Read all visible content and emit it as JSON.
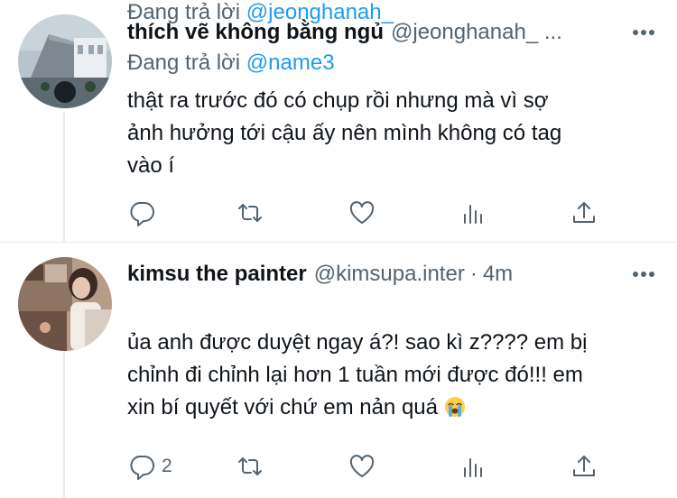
{
  "replies": [
    {
      "display_name": "thích vẽ không bằng ngủ",
      "handle": "@jeonghanah_ ...",
      "timestamp": "",
      "replying_prefix": "Đang trả lời",
      "replying_to": "@name3",
      "lines": [
        "thật ra trước đó có chụp rồi nhưng mà vì sợ",
        "ảnh hưởng tới cậu ấy nên mình không có tag",
        "vào í"
      ],
      "counts": {
        "reply": "",
        "retweet": "",
        "like": ""
      }
    },
    {
      "display_name": "kimsu the painter",
      "handle": "@kimsupa.inter",
      "timestamp": "4m",
      "separator": "·",
      "replying_prefix": "Đang trả lời",
      "replying_to": "@jeonghanah_",
      "lines": [
        "ủa anh được duyệt ngay á?! sao kì z???? em bị",
        "chỉnh đi chỉnh lại hơn 1 tuần mới được đó!!! em",
        "xin bí quyết với chứ em nản quá"
      ],
      "emoji": "loudly-crying-face",
      "counts": {
        "reply": "2",
        "retweet": "",
        "like": ""
      }
    }
  ],
  "icons": {
    "reply": "speech-bubble-icon",
    "retweet": "retweet-arrows-icon",
    "like": "heart-outline-icon",
    "analytics": "bar-chart-icon",
    "share": "share-upload-icon",
    "more": "more-dots-icon"
  },
  "colors": {
    "text": "#0f1419",
    "secondary": "#536471",
    "link": "#1d9bf0",
    "divider": "#e6ecf0"
  }
}
